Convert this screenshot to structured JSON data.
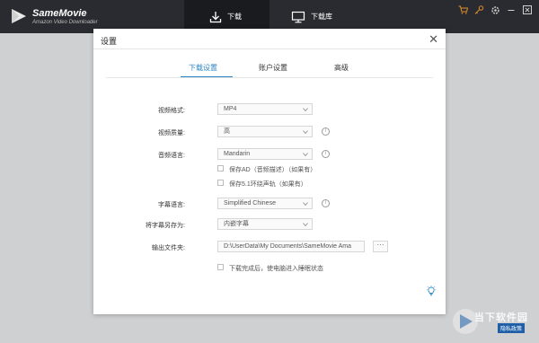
{
  "app": {
    "name": "SameMovie",
    "subtitle": "Amazon Video Downloader"
  },
  "nav": {
    "tabs": [
      {
        "label": "下载",
        "icon": "download-icon",
        "active": true
      },
      {
        "label": "下载库",
        "icon": "monitor-icon",
        "active": false
      }
    ]
  },
  "window_controls": [
    "cart-icon",
    "key-icon",
    "gear-icon",
    "minimize-icon",
    "close-icon"
  ],
  "dialog": {
    "title": "设置",
    "tabs": [
      {
        "label": "下载设置",
        "active": true
      },
      {
        "label": "账户设置",
        "active": false
      },
      {
        "label": "高级",
        "active": false
      }
    ],
    "fields": {
      "video_format": {
        "label": "视频格式:",
        "value": "MP4"
      },
      "video_quality": {
        "label": "视频质量:",
        "value": "高"
      },
      "audio_language": {
        "label": "音频语言:",
        "value": "Mandarin"
      },
      "save_ad": {
        "label": "保存AD（音频描述）（如果有）",
        "checked": false
      },
      "save_51": {
        "label": "保存5.1环绕声轨（如果有）",
        "checked": false
      },
      "subtitle_language": {
        "label": "字幕语言:",
        "value": "Simplified Chinese"
      },
      "save_subtitle_as": {
        "label": "将字幕另存为:",
        "value": "内嵌字幕"
      },
      "output_folder": {
        "label": "输出文件夹:",
        "value": "D:\\UserData\\My Documents\\SameMovie Ama",
        "browse_label": "···"
      },
      "sleep_after": {
        "label": "下载完成后，使电脑进入睡眠状态",
        "checked": false
      }
    }
  },
  "watermark": {
    "text": "当下软件园",
    "sub": "隐私政策"
  },
  "colors": {
    "titlebar": "#2a2b30",
    "accent": "#2b86c5",
    "window_controls": "#e0902a"
  }
}
